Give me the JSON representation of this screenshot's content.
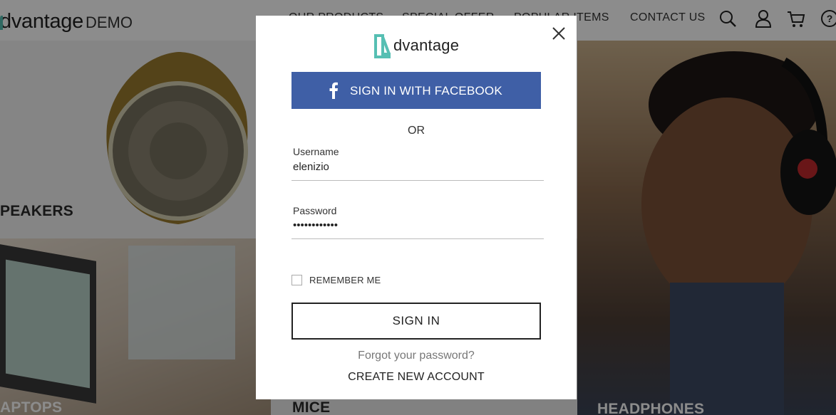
{
  "header": {
    "logo_text": "dvantage",
    "logo_suffix": "DEMO",
    "nav": [
      "OUR PRODUCTS",
      "SPECIAL OFFER",
      "POPULAR ITEMS",
      "CONTACT US"
    ],
    "icons": [
      "search-icon",
      "user-icon",
      "cart-icon",
      "help-icon"
    ]
  },
  "categories": {
    "speakers": "PEAKERS",
    "laptops": "APTOPS",
    "mice": "MICE",
    "headphones": "HEADPHONES"
  },
  "modal": {
    "logo_text": "dvantage",
    "facebook_label": "SIGN IN WITH FACEBOOK",
    "or_text": "OR",
    "username_label": "Username",
    "username_value": "elenizio",
    "password_label": "Password",
    "password_value": "••••••••••••",
    "remember_label": "REMEMBER ME",
    "signin_label": "SIGN IN",
    "forgot_label": "Forgot your password?",
    "create_label": "CREATE NEW ACCOUNT"
  },
  "colors": {
    "brand_teal": "#56bfb3",
    "facebook_blue": "#3f5fa6"
  }
}
